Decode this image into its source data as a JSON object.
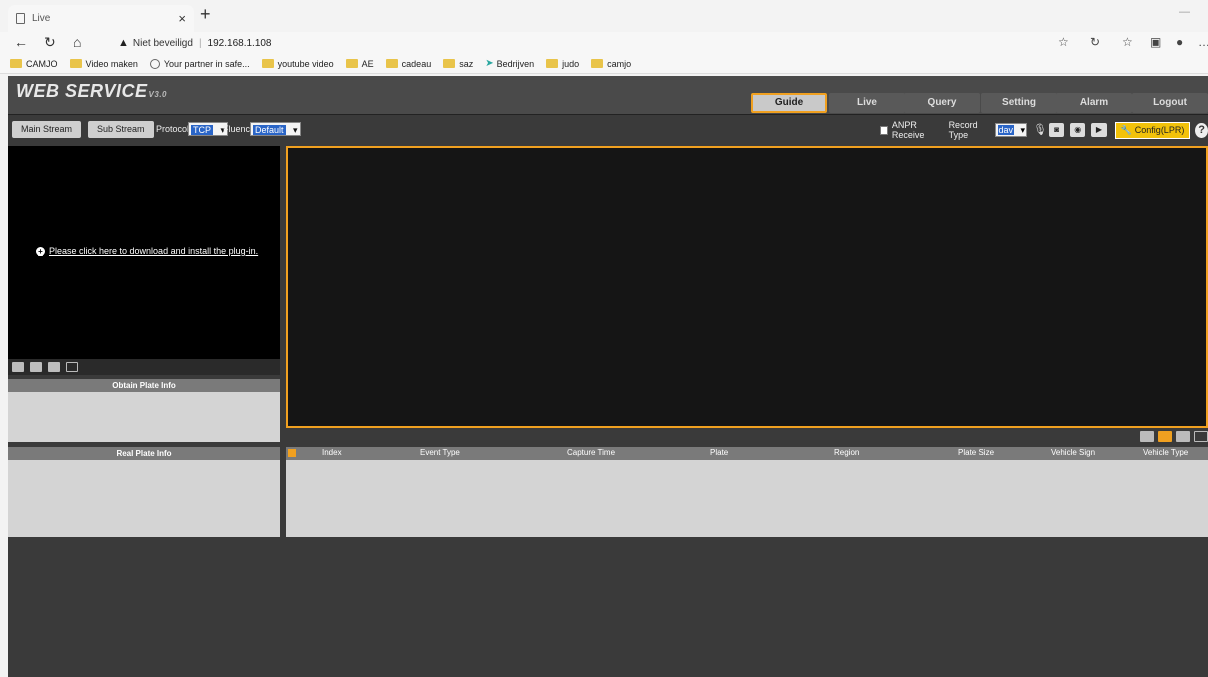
{
  "browser": {
    "tab_title": "Live",
    "close_glyph": "×",
    "new_tab_glyph": "+",
    "security_label": "Niet beveiligd",
    "url": "192.168.1.108",
    "bookmarks": [
      {
        "label": "CAMJO",
        "icon": "folder-icon"
      },
      {
        "label": "Video maken",
        "icon": "folder-icon"
      },
      {
        "label": "Your partner in safe...",
        "icon": "globe-icon"
      },
      {
        "label": "youtube video",
        "icon": "folder-icon"
      },
      {
        "label": "AE",
        "icon": "folder-icon"
      },
      {
        "label": "cadeau",
        "icon": "folder-icon"
      },
      {
        "label": "saz",
        "icon": "folder-icon"
      },
      {
        "label": "Bedrijven",
        "icon": "bird-icon"
      },
      {
        "label": "judo",
        "icon": "folder-icon"
      },
      {
        "label": "camjo",
        "icon": "folder-icon"
      }
    ]
  },
  "app": {
    "logo": "WEB SERVICE",
    "logo_version": "V3.0",
    "nav": [
      "Guide",
      "Live",
      "Query",
      "Setting",
      "Alarm",
      "Logout"
    ],
    "active_nav": "Guide"
  },
  "toolbar": {
    "main_stream": "Main Stream",
    "sub_stream": "Sub Stream",
    "protocol_label": "Protocol",
    "protocol_value": "TCP",
    "fluency_label": "Fluency",
    "fluency_value": "Default",
    "anpr_label": "ANPR Receive",
    "record_type_label": "Record Type",
    "record_type_value": "dav",
    "config_label": "Config(LPR)",
    "help_glyph": "?"
  },
  "video": {
    "plugin_message": "Please click here to download and install the plug-in."
  },
  "panels": {
    "obtain_plate": "Obtain Plate Info",
    "real_plate": "Real Plate Info"
  },
  "events": {
    "columns": [
      "Index",
      "Event Type",
      "Capture Time",
      "Plate",
      "Region",
      "Plate Size",
      "Vehicle Sign",
      "Vehicle Type"
    ]
  },
  "colors": {
    "accent": "#f0a020",
    "config_button": "#f2c20a",
    "app_background": "#3a3a3a"
  }
}
